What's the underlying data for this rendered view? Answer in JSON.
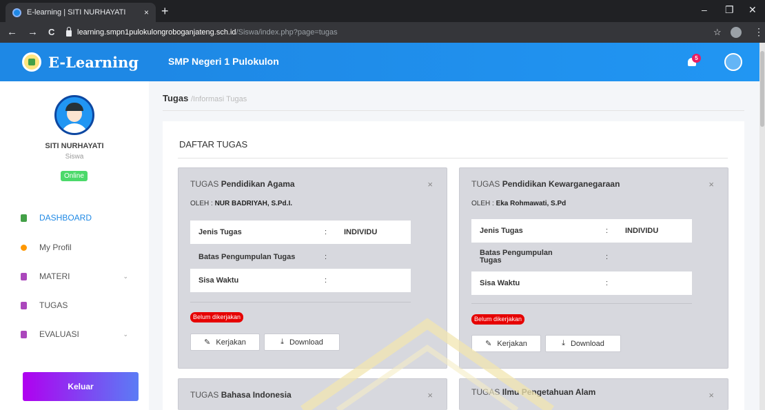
{
  "browser": {
    "tab_title": "E-learning | SITI NURHAYATI",
    "tab_close": "×",
    "new_tab": "+",
    "url_host": "learning.smpn1pulokulongroboganjateng.sch.id",
    "url_path": "/Siswa/index.php?page=tugas",
    "win_min": "–",
    "win_max": "❐",
    "win_close": "✕",
    "back": "←",
    "forward": "→",
    "reload": "C",
    "bookmark": "☆",
    "menu": "⋮"
  },
  "header": {
    "brand": "E-Learning",
    "school": "SMP Negeri 1 Pulokulon",
    "notif_count": "5"
  },
  "sidebar": {
    "user_name": "SITI NURHAYATI",
    "user_role": "Siswa",
    "status": "Online",
    "items": [
      {
        "label": "DASHBOARD",
        "icon": "dashboard-icon",
        "color": "#43a047"
      },
      {
        "label": "My Profil",
        "icon": "profile-icon",
        "color": "#ff9800"
      },
      {
        "label": "MATERI",
        "icon": "document-icon",
        "color": "#ab47bc",
        "chevron": "⌄"
      },
      {
        "label": "TUGAS",
        "icon": "document-icon",
        "color": "#ab47bc"
      },
      {
        "label": "EVALUASI",
        "icon": "document-icon",
        "color": "#ab47bc",
        "chevron": "⌄"
      }
    ],
    "logout": "Keluar"
  },
  "main": {
    "breadcrumb_current": "Tugas",
    "breadcrumb_rest": "/Informasi Tugas",
    "panel_title": "DAFTAR TUGAS",
    "close_symbol": "×",
    "cards": [
      {
        "prefix": "TUGAS",
        "subject": "Pendidikan Agama",
        "author_prefix": "OLEH :",
        "author": "NUR BADRIYAH, S.Pd.I.",
        "rows": [
          {
            "key": "Jenis Tugas",
            "sep": ":",
            "value": "INDIVIDU"
          },
          {
            "key": "Batas Pengumpulan Tugas",
            "sep": ":",
            "value": ""
          },
          {
            "key": "Sisa Waktu",
            "sep": ":",
            "value": ""
          }
        ],
        "status": "Belum dikerjakan",
        "btn_work": "Kerjakan",
        "btn_download": "Download"
      },
      {
        "prefix": "TUGAS",
        "subject": "Pendidikan Kewarganegaraan",
        "author_prefix": "OLEH :",
        "author": "Eka Rohmawati, S.Pd",
        "rows": [
          {
            "key": "Jenis Tugas",
            "sep": ":",
            "value": "INDIVIDU"
          },
          {
            "key": "Batas Pengumpulan Tugas",
            "sep": ":",
            "value": ""
          },
          {
            "key": "Sisa Waktu",
            "sep": ":",
            "value": ""
          }
        ],
        "status": "Belum dikerjakan",
        "btn_work": "Kerjakan",
        "btn_download": "Download"
      },
      {
        "prefix": "TUGAS",
        "subject": "Bahasa Indonesia"
      },
      {
        "prefix": "TUGAS",
        "subject": "Ilmu Pengetahuan Alam"
      }
    ]
  },
  "colors": {
    "primary": "#1e88e5",
    "status_red": "#e60000",
    "online_green": "#4cd96a"
  }
}
